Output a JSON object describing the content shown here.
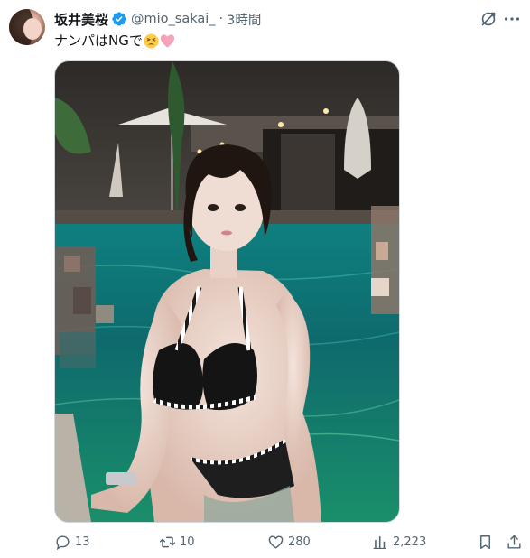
{
  "author": {
    "display_name": "坂井美桜",
    "handle": "@mio_sakai_",
    "separator": "·",
    "time": "3時間",
    "verified": true
  },
  "tweet": {
    "text": "ナンパはNGで",
    "emojis": [
      "tired-face-emoji",
      "pink-heart-emoji"
    ]
  },
  "media": {
    "description_icon": "photo"
  },
  "actions": {
    "replies": "13",
    "retweets": "10",
    "likes": "280",
    "views": "2,223"
  },
  "colors": {
    "text": "#0f1419",
    "muted": "#536471",
    "verified": "#1d9bf0",
    "border": "#cfd9de"
  }
}
